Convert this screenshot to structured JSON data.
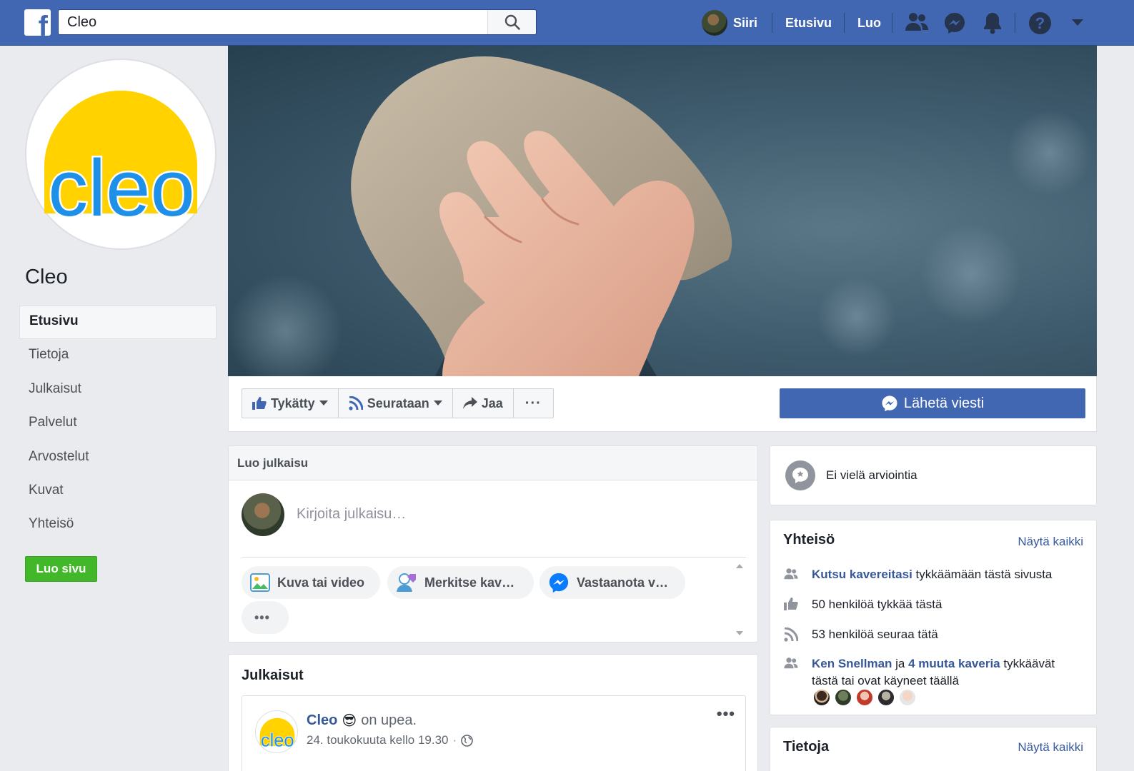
{
  "search": {
    "value": "Cleo"
  },
  "topbar": {
    "user_name": "Siiri",
    "home": "Etusivu",
    "create": "Luo",
    "help": "?"
  },
  "page": {
    "name": "Cleo",
    "logo_text": "cleo",
    "create_page": "Luo sivu"
  },
  "sidebar": {
    "items": [
      {
        "label": "Etusivu",
        "active": true
      },
      {
        "label": "Tietoja"
      },
      {
        "label": "Julkaisut"
      },
      {
        "label": "Palvelut"
      },
      {
        "label": "Arvostelut"
      },
      {
        "label": "Kuvat"
      },
      {
        "label": "Yhteisö"
      }
    ]
  },
  "actions": {
    "liked": "Tykätty",
    "following": "Seurataan",
    "share": "Jaa",
    "more": "···",
    "send_message": "Lähetä viesti"
  },
  "composer": {
    "title": "Luo julkaisu",
    "placeholder": "Kirjoita julkaisu…",
    "options": [
      {
        "label": "Kuva tai video",
        "icon": "photo-icon"
      },
      {
        "label": "Merkitse kav…",
        "icon": "tag-friends-icon"
      },
      {
        "label": "Vastaanota v…",
        "icon": "messenger-icon"
      }
    ],
    "more": "•••"
  },
  "posts": {
    "title": "Julkaisut",
    "post": {
      "author": "Cleo",
      "emoji": "😎",
      "status": "on upea.",
      "time": "24. toukokuuta kello 19.30",
      "more": "•••"
    }
  },
  "reviews": {
    "text": "Ei vielä arviointia"
  },
  "community": {
    "title": "Yhteisö",
    "see_all": "Näytä kaikki",
    "invite_link": "Kutsu kavereitasi",
    "invite_rest": " tykkäämään tästä sivusta",
    "likes": "50 henkilöä tykkää tästä",
    "follows": "53 henkilöä seuraa tätä",
    "friend_name": "Ken Snellman",
    "friend_and": " ja ",
    "friend_others": "4 muuta kaveria",
    "friend_rest": " tykkäävät tästä tai ovat käyneet täällä"
  },
  "about": {
    "title": "Tietoja",
    "see_all": "Näytä kaikki"
  },
  "colors": {
    "brand_blue": "#4267b2",
    "link_blue": "#365899",
    "green": "#42b72a",
    "logo_yellow": "#ffd200",
    "logo_blue": "#1e90e8"
  }
}
